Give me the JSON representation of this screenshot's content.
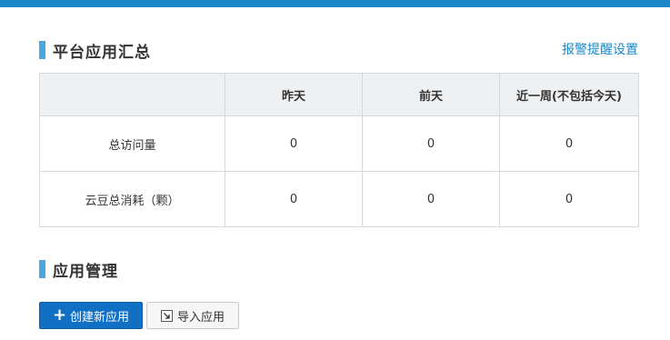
{
  "platform_summary": {
    "title": "平台应用汇总",
    "alert_link": "报警提醒设置",
    "columns": [
      "",
      "昨天",
      "前天",
      "近一周(不包括今天)"
    ],
    "rows": [
      {
        "label": "总访问量",
        "values": [
          "0",
          "0",
          "0"
        ]
      },
      {
        "label": "云豆总消耗（颗）",
        "values": [
          "0",
          "0",
          "0"
        ]
      }
    ]
  },
  "app_management": {
    "title": "应用管理",
    "create_button": "创建新应用",
    "import_button": "导入应用"
  },
  "colors": {
    "top_bar": "#1a87c9",
    "accent_bar": "#4aa8e0",
    "link": "#1a87c9",
    "primary_button": "#1270c4",
    "table_header_bg": "#eef0f2"
  },
  "icons": {
    "create": "plus-icon",
    "import": "import-icon"
  }
}
